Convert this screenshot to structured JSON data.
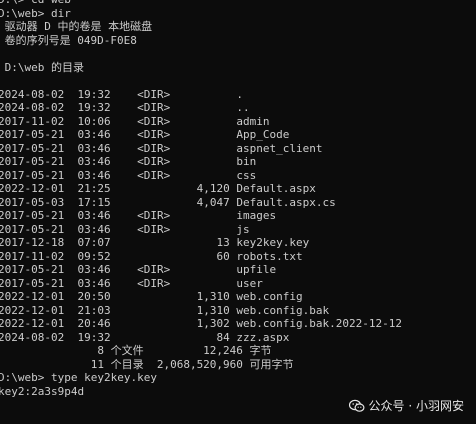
{
  "window": {
    "type": "command-prompt"
  },
  "lines": [
    "D:\\> cd web",
    "D:\\web> dir",
    " 驱动器 D 中的卷是 本地磁盘",
    " 卷的序列号是 049D-F0E8",
    "",
    " D:\\web 的目录",
    "",
    "2024-08-02  19:32    <DIR>          .",
    "2024-08-02  19:32    <DIR>          ..",
    "2017-11-02  10:06    <DIR>          admin",
    "2017-05-21  03:46    <DIR>          App_Code",
    "2017-05-21  03:46    <DIR>          aspnet_client",
    "2017-05-21  03:46    <DIR>          bin",
    "2017-05-21  03:46    <DIR>          css",
    "2022-12-01  21:25             4,120 Default.aspx",
    "2017-05-03  17:15             4,047 Default.aspx.cs",
    "2017-05-21  03:46    <DIR>          images",
    "2017-05-21  03:46    <DIR>          js",
    "2017-12-18  07:07                13 key2key.key",
    "2017-11-02  09:52                60 robots.txt",
    "2017-05-21  03:46    <DIR>          upfile",
    "2017-05-21  03:46    <DIR>          user",
    "2022-12-01  20:50             1,310 web.config",
    "2022-12-01  21:03             1,310 web.config.bak",
    "2022-12-01  20:46             1,302 web.config.bak.2022-12-12",
    "2024-08-02  19:32                84 zzz.aspx",
    "               8 个文件         12,246 字节",
    "              11 个目录  2,068,520,960 可用字节",
    "D:\\web> type key2key.key",
    "key2:2a3s9p4d"
  ],
  "watermark": {
    "icon": "wechat-icon",
    "text": "公众号 · 小羽网安",
    "color": "#e6e6e6"
  },
  "colors": {
    "background": "#0c0c0c",
    "text": "#cccccc"
  }
}
